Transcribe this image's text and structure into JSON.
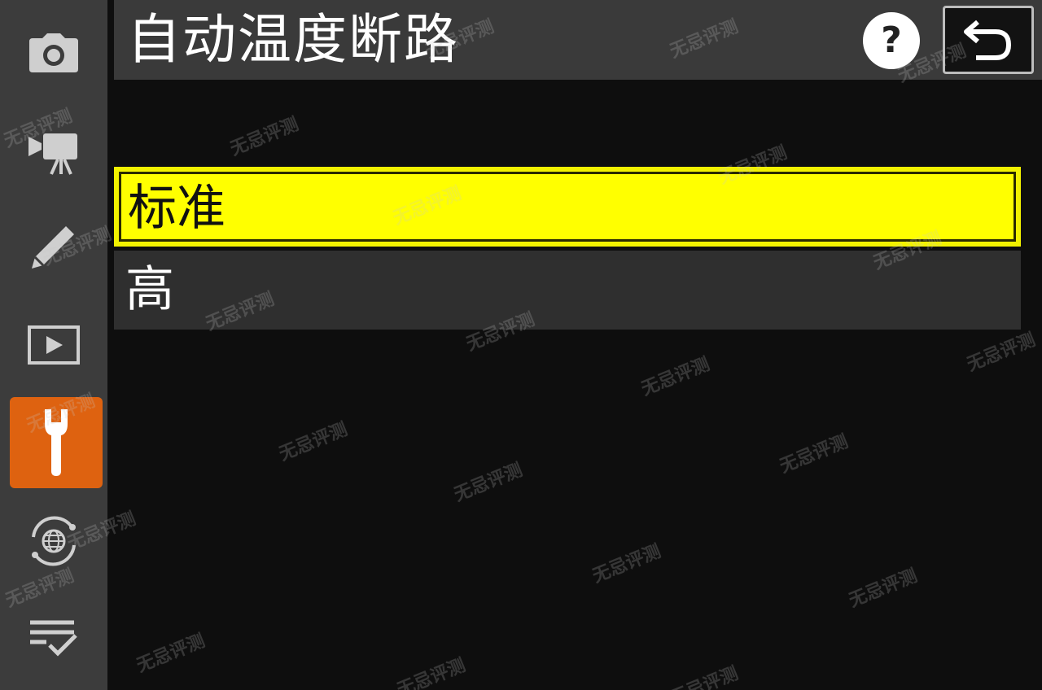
{
  "header": {
    "title": "自动温度断路",
    "help_label": "?",
    "help_icon": "question-mark-icon",
    "back_icon": "return-arrow-icon"
  },
  "sidebar": {
    "items": [
      {
        "icon": "camera-icon",
        "active": false
      },
      {
        "icon": "movie-camera-icon",
        "active": false
      },
      {
        "icon": "pencil-icon",
        "active": false
      },
      {
        "icon": "playback-icon",
        "active": false
      },
      {
        "icon": "wrench-icon",
        "active": true
      },
      {
        "icon": "network-globe-icon",
        "active": false
      },
      {
        "icon": "my-menu-checklist-icon",
        "active": false
      }
    ]
  },
  "options": [
    {
      "label": "标准",
      "selected": true
    },
    {
      "label": "高",
      "selected": false
    }
  ],
  "watermark": "无忌评测",
  "colors": {
    "background": "#0e0e0e",
    "sidebar": "#3c3c3c",
    "header": "#3a3a3a",
    "highlight": "#ffff00",
    "active_tab": "#de6210",
    "option_bg": "#2f2f2f",
    "text": "#ffffff"
  }
}
